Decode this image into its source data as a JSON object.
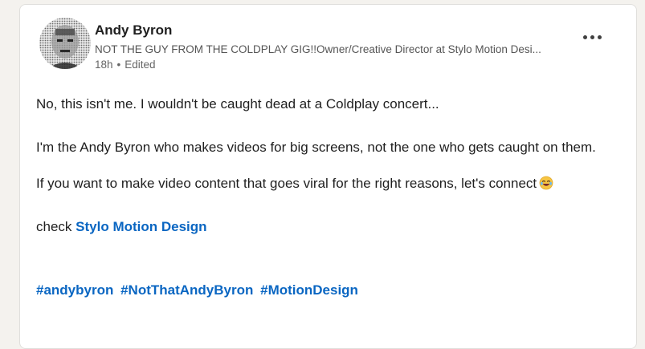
{
  "post": {
    "author": {
      "name": "Andy Byron",
      "headline": "NOT THE GUY FROM THE COLDPLAY GIG!!Owner/Creative Director at Stylo Motion Desi...",
      "time": "18h",
      "separator": "•",
      "edited": "Edited"
    },
    "text": {
      "line1": "No, this isn't me. I wouldn't be caught dead at a Coldplay concert...",
      "line2": "I'm the Andy Byron who makes videos for big screens, not the one who gets caught on them.",
      "line3": "If you want to make video content that goes viral for the right reasons, let's connect",
      "line4_prefix": "check",
      "company_link": "Stylo Motion Design"
    },
    "hashtags": [
      "#andybyron",
      "#NotThatAndyByron",
      "#MotionDesign"
    ]
  },
  "icons": {
    "more": "more-horizontal-icon",
    "emoji": "laughing-tears-emoji-icon"
  }
}
